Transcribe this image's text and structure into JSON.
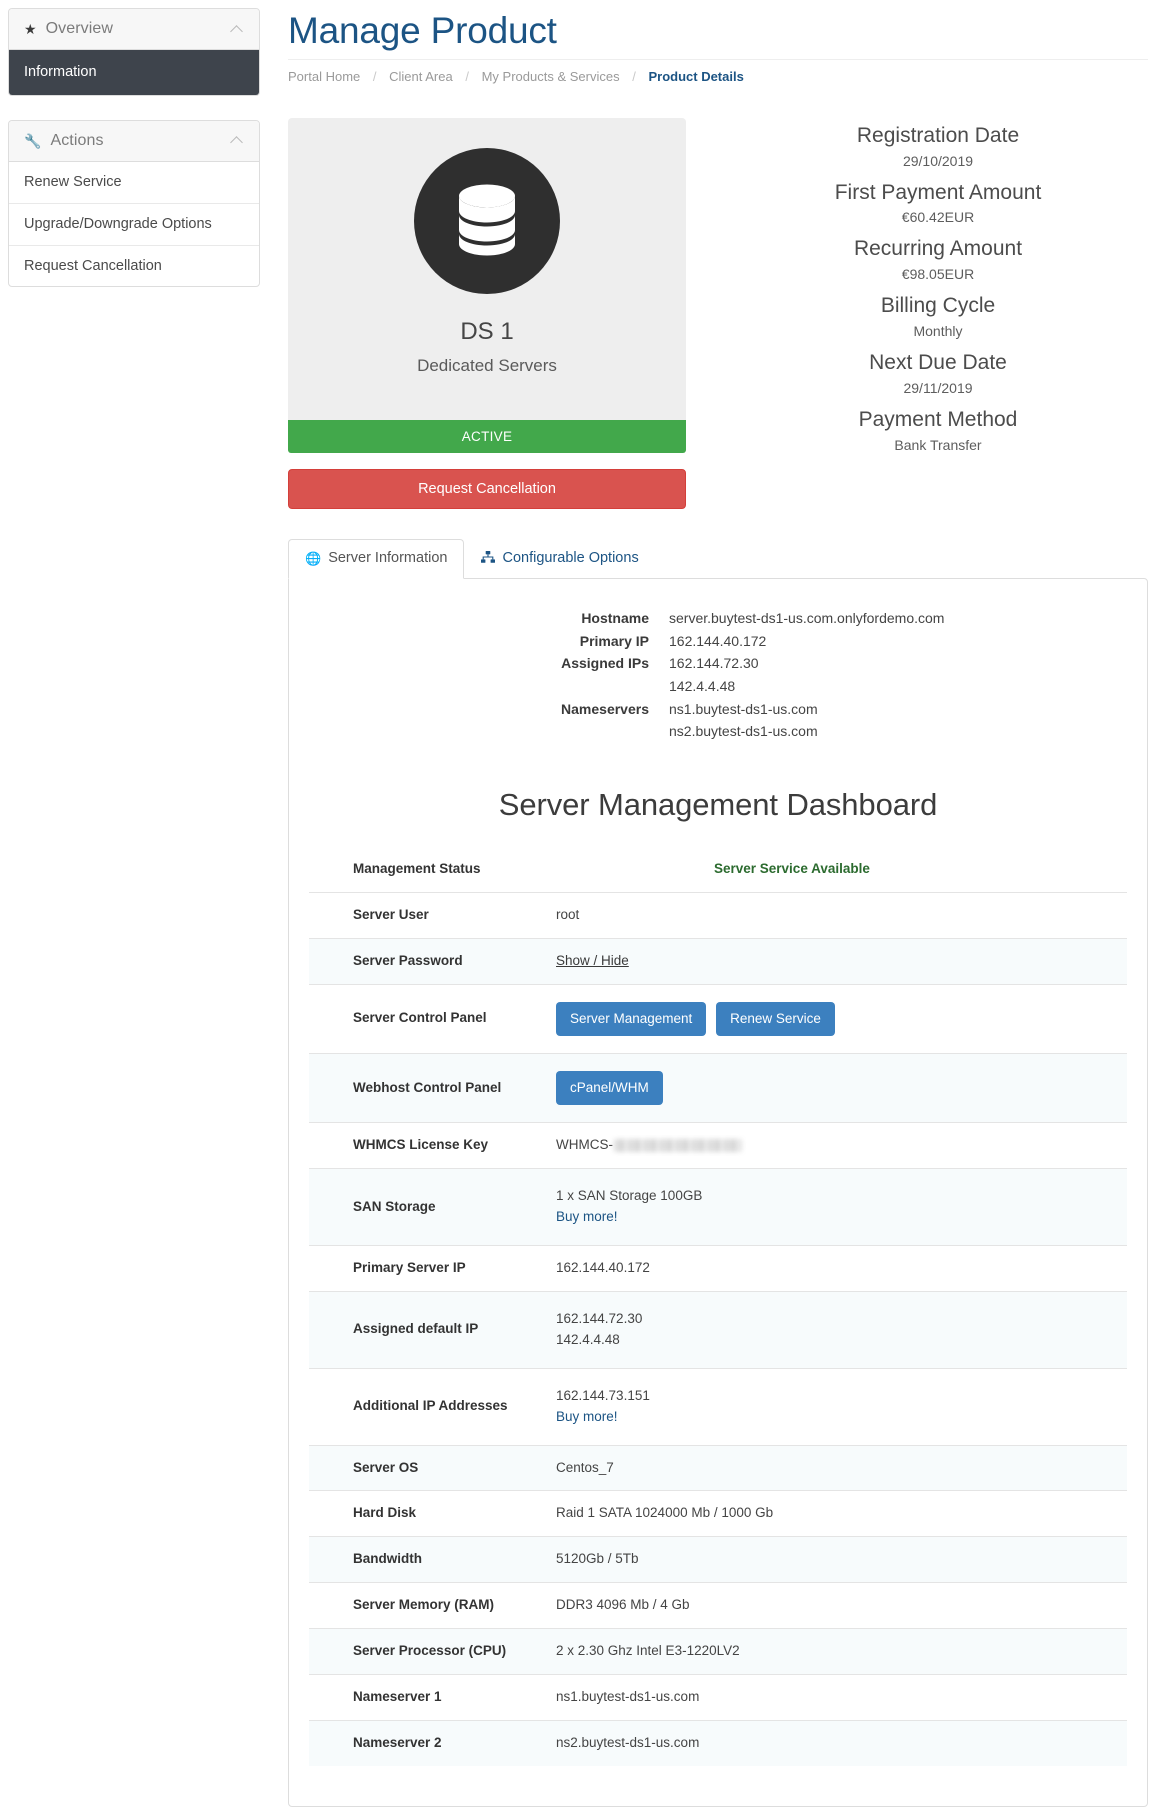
{
  "sidebar": {
    "overview": {
      "title": "Overview",
      "icon": "star-icon",
      "items": [
        {
          "label": "Information",
          "active": true
        }
      ]
    },
    "actions": {
      "title": "Actions",
      "icon": "wrench-icon",
      "items": [
        {
          "label": "Renew Service"
        },
        {
          "label": "Upgrade/Downgrade Options"
        },
        {
          "label": "Request Cancellation"
        }
      ]
    }
  },
  "header": {
    "title": "Manage Product",
    "breadcrumb": [
      "Portal Home",
      "Client Area",
      "My Products & Services",
      "Product Details"
    ],
    "breadcrumb_current": "Product Details"
  },
  "product": {
    "icon": "database-icon",
    "name": "DS 1",
    "group": "Dedicated Servers",
    "status": "ACTIVE",
    "status_color": "#42a84b",
    "cancel_button": "Request Cancellation",
    "cancel_color": "#d9534f"
  },
  "billing": [
    {
      "label": "Registration Date",
      "value": "29/10/2019"
    },
    {
      "label": "First Payment Amount",
      "value": "€60.42EUR"
    },
    {
      "label": "Recurring Amount",
      "value": "€98.05EUR"
    },
    {
      "label": "Billing Cycle",
      "value": "Monthly"
    },
    {
      "label": "Next Due Date",
      "value": "29/11/2019"
    },
    {
      "label": "Payment Method",
      "value": "Bank Transfer"
    }
  ],
  "tabs": [
    {
      "label": "Server Information",
      "icon": "globe-icon",
      "active": true
    },
    {
      "label": "Configurable Options",
      "icon": "sitemap-icon",
      "active": false
    }
  ],
  "server_info": {
    "labels": [
      "Hostname",
      "Primary IP",
      "Assigned IPs",
      "",
      "Nameservers",
      ""
    ],
    "hostname_label": "Hostname",
    "hostname": "server.buytest-ds1-us.com.onlyfordemo.com",
    "primary_ip_label": "Primary IP",
    "primary_ip": "162.144.40.172",
    "assigned_ips_label": "Assigned IPs",
    "assigned_ip_1": "162.144.72.30",
    "assigned_ip_2": "142.4.4.48",
    "nameservers_label": "Nameservers",
    "nameserver_1": "ns1.buytest-ds1-us.com",
    "nameserver_2": "ns2.buytest-ds1-us.com"
  },
  "dashboard": {
    "title": "Server Management Dashboard",
    "col1_header": "Management Status",
    "col2_header": "Server Service Available",
    "col2_header_color": "#2c6b2f",
    "rows": [
      {
        "key": "Server User",
        "value": "root",
        "type": "text"
      },
      {
        "key": "Server Password",
        "value": "Show / Hide",
        "type": "link-underline"
      },
      {
        "key": "Server Control Panel",
        "type": "buttons",
        "buttons": [
          "Server Management",
          "Renew Service"
        ]
      },
      {
        "key": "Webhost Control Panel",
        "type": "buttons",
        "buttons": [
          "cPanel/WHM"
        ]
      },
      {
        "key": "WHMCS License Key",
        "value": "WHMCS-",
        "type": "redacted"
      },
      {
        "key": "SAN Storage",
        "value": "1 x SAN Storage 100GB",
        "link": "Buy more!",
        "type": "text-link"
      },
      {
        "key": "Primary Server IP",
        "value": "162.144.40.172",
        "type": "text"
      },
      {
        "key": "Assigned default IP",
        "value": "162.144.72.30",
        "value2": "142.4.4.48",
        "type": "text-2"
      },
      {
        "key": "Additional IP Addresses",
        "value": "162.144.73.151",
        "link": "Buy more!",
        "type": "text-link"
      },
      {
        "key": "Server OS",
        "value": "Centos_7",
        "type": "text"
      },
      {
        "key": "Hard Disk",
        "value": "Raid 1 SATA 1024000 Mb / 1000 Gb",
        "type": "text"
      },
      {
        "key": "Bandwidth",
        "value": "5120Gb / 5Tb",
        "type": "text"
      },
      {
        "key": "Server Memory (RAM)",
        "value": "DDR3 4096 Mb / 4 Gb",
        "type": "text"
      },
      {
        "key": "Server Processor (CPU)",
        "value": "2 x 2.30 Ghz Intel E3-1220LV2",
        "type": "text"
      },
      {
        "key": "Nameserver 1",
        "value": "ns1.buytest-ds1-us.com",
        "type": "text"
      },
      {
        "key": "Nameserver 2",
        "value": "ns2.buytest-ds1-us.com",
        "type": "text"
      }
    ]
  },
  "colors": {
    "accent": "#1c5484",
    "button_blue": "#3c80bf",
    "sidebar_active": "#3e444c"
  }
}
